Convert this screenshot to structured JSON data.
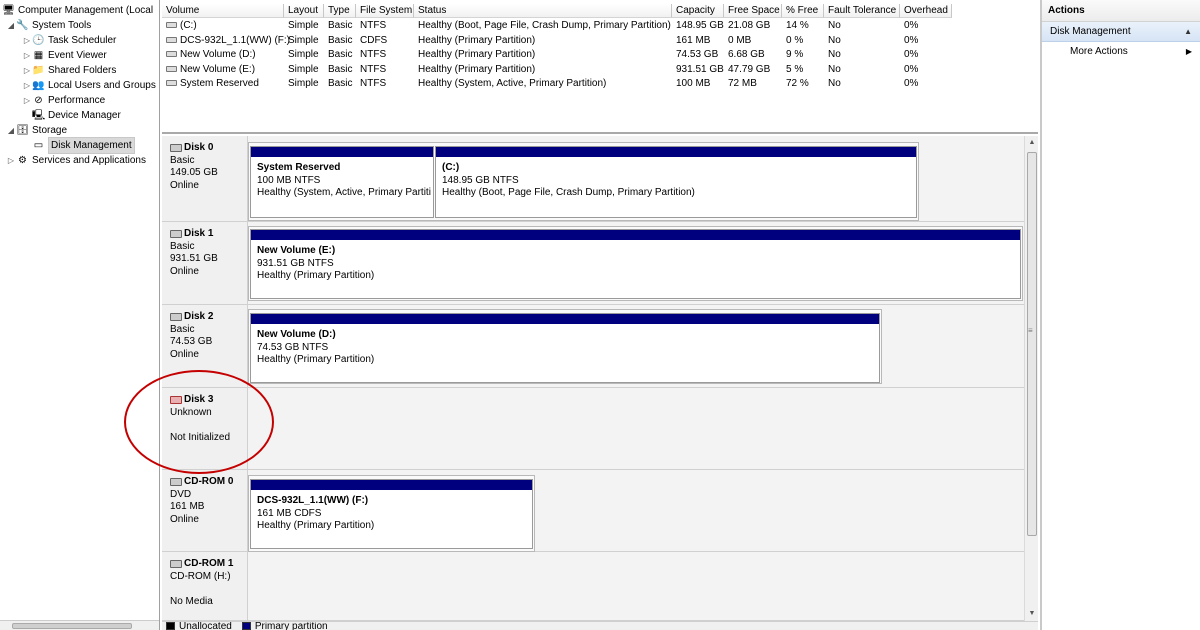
{
  "tree": {
    "items": [
      {
        "label": "Computer Management (Local",
        "icon": "computer-icon",
        "arrow": "",
        "indent": 0
      },
      {
        "label": "System Tools",
        "icon": "tools-icon",
        "arrow": "◢",
        "indent": 1
      },
      {
        "label": "Task Scheduler",
        "icon": "clock-icon",
        "arrow": "▷",
        "indent": 2
      },
      {
        "label": "Event Viewer",
        "icon": "event-viewer-icon",
        "arrow": "▷",
        "indent": 2
      },
      {
        "label": "Shared Folders",
        "icon": "shared-folder-icon",
        "arrow": "▷",
        "indent": 2
      },
      {
        "label": "Local Users and Groups",
        "icon": "users-icon",
        "arrow": "▷",
        "indent": 2
      },
      {
        "label": "Performance",
        "icon": "performance-icon",
        "arrow": "▷",
        "indent": 2
      },
      {
        "label": "Device Manager",
        "icon": "device-manager-icon",
        "arrow": "",
        "indent": 2
      },
      {
        "label": "Storage",
        "icon": "storage-icon",
        "arrow": "◢",
        "indent": 1
      },
      {
        "label": "Disk Management",
        "icon": "disk-management-icon",
        "arrow": "",
        "indent": 2,
        "selected": true
      },
      {
        "label": "Services and Applications",
        "icon": "services-icon",
        "arrow": "▷",
        "indent": 1
      }
    ]
  },
  "volume_list": {
    "headers": [
      "Volume",
      "Layout",
      "Type",
      "File System",
      "Status",
      "Capacity",
      "Free Space",
      "% Free",
      "Fault Tolerance",
      "Overhead"
    ],
    "rows": [
      [
        "(C:)",
        "Simple",
        "Basic",
        "NTFS",
        "Healthy (Boot, Page File, Crash Dump, Primary Partition)",
        "148.95 GB",
        "21.08 GB",
        "14 %",
        "No",
        "0%"
      ],
      [
        "DCS-932L_1.1(WW) (F:)",
        "Simple",
        "Basic",
        "CDFS",
        "Healthy (Primary Partition)",
        "161 MB",
        "0 MB",
        "0 %",
        "No",
        "0%"
      ],
      [
        "New Volume (D:)",
        "Simple",
        "Basic",
        "NTFS",
        "Healthy (Primary Partition)",
        "74.53 GB",
        "6.68 GB",
        "9 %",
        "No",
        "0%"
      ],
      [
        "New Volume (E:)",
        "Simple",
        "Basic",
        "NTFS",
        "Healthy (Primary Partition)",
        "931.51 GB",
        "47.79 GB",
        "5 %",
        "No",
        "0%"
      ],
      [
        "System Reserved",
        "Simple",
        "Basic",
        "NTFS",
        "Healthy (System, Active, Primary Partition)",
        "100 MB",
        "72 MB",
        "72 %",
        "No",
        "0%"
      ]
    ]
  },
  "disks": [
    {
      "name": "Disk 0",
      "lines": [
        "Basic",
        "149.05 GB",
        "Online"
      ],
      "partitions": [
        {
          "title": "System Reserved",
          "size": "100 MB NTFS",
          "status": "Healthy (System, Active, Primary Partiti"
        },
        {
          "title": "(C:)",
          "size": "148.95 GB NTFS",
          "status": "Healthy (Boot, Page File, Crash Dump, Primary Partition)"
        }
      ]
    },
    {
      "name": "Disk 1",
      "lines": [
        "Basic",
        "931.51 GB",
        "Online"
      ],
      "partitions": [
        {
          "title": "New Volume  (E:)",
          "size": "931.51 GB NTFS",
          "status": "Healthy (Primary Partition)"
        }
      ]
    },
    {
      "name": "Disk 2",
      "lines": [
        "Basic",
        "74.53 GB",
        "Online"
      ],
      "partitions": [
        {
          "title": "New Volume  (D:)",
          "size": "74.53 GB NTFS",
          "status": "Healthy (Primary Partition)"
        }
      ]
    },
    {
      "name": "Disk 3",
      "lines": [
        "Unknown",
        "",
        "Not Initialized"
      ],
      "partitions": []
    },
    {
      "name": "CD-ROM 0",
      "lines": [
        "DVD",
        "161 MB",
        "Online"
      ],
      "partitions": [
        {
          "title": "DCS-932L_1.1(WW)  (F:)",
          "size": "161 MB CDFS",
          "status": "Healthy (Primary Partition)"
        }
      ]
    },
    {
      "name": "CD-ROM 1",
      "lines": [
        "CD-ROM (H:)",
        "",
        "No Media"
      ],
      "partitions": []
    }
  ],
  "legend": {
    "items": [
      {
        "label": "Unallocated",
        "color": "#000000"
      },
      {
        "label": "Primary partition",
        "color": "#00007f"
      }
    ]
  },
  "actions": {
    "title": "Actions",
    "section": "Disk Management",
    "items": [
      "More Actions"
    ]
  },
  "colors": {
    "partition_bar": "#00007f",
    "annotation": "#c40000"
  }
}
